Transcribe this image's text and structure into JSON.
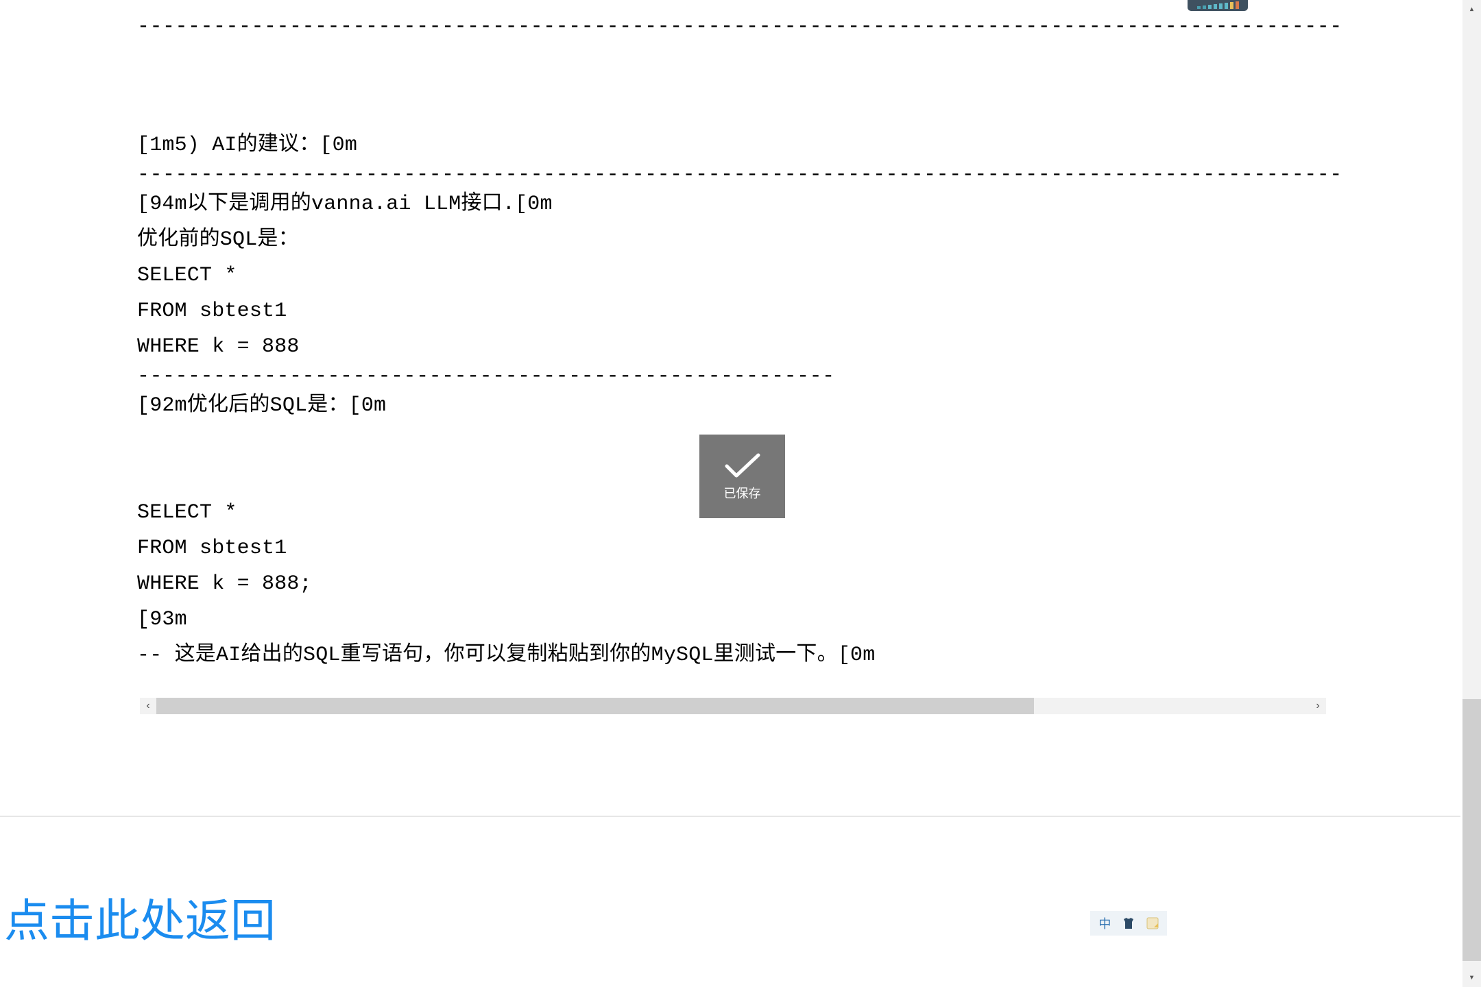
{
  "dashes_long": "------------------------------------------------------------------------------------------------------------------------",
  "dashes_mid": "-------------------------------------------------------",
  "output": {
    "heading": "[1m5) AI的建议：[0m",
    "intro": "[94m以下是调用的vanna.ai LLM接口.[0m",
    "before_label": "优化前的SQL是：",
    "before_sql_1": "SELECT *",
    "before_sql_2": "FROM sbtest1",
    "before_sql_3": "WHERE k = 888",
    "after_label": "[92m优化后的SQL是：[0m",
    "after_sql_1": "SELECT *",
    "after_sql_2": "FROM sbtest1",
    "after_sql_3": "WHERE k = 888;",
    "after_sql_4": "[93m",
    "comment": "-- 这是AI给出的SQL重写语句，你可以复制粘贴到你的MySQL里测试一下。[0m"
  },
  "toast": {
    "label": "已保存"
  },
  "footer": {
    "return_label": "点击此处返回"
  },
  "ime": {
    "zhong": "中"
  },
  "scroll": {
    "left": "‹",
    "right": "›",
    "up": "▴",
    "down": "▾"
  }
}
